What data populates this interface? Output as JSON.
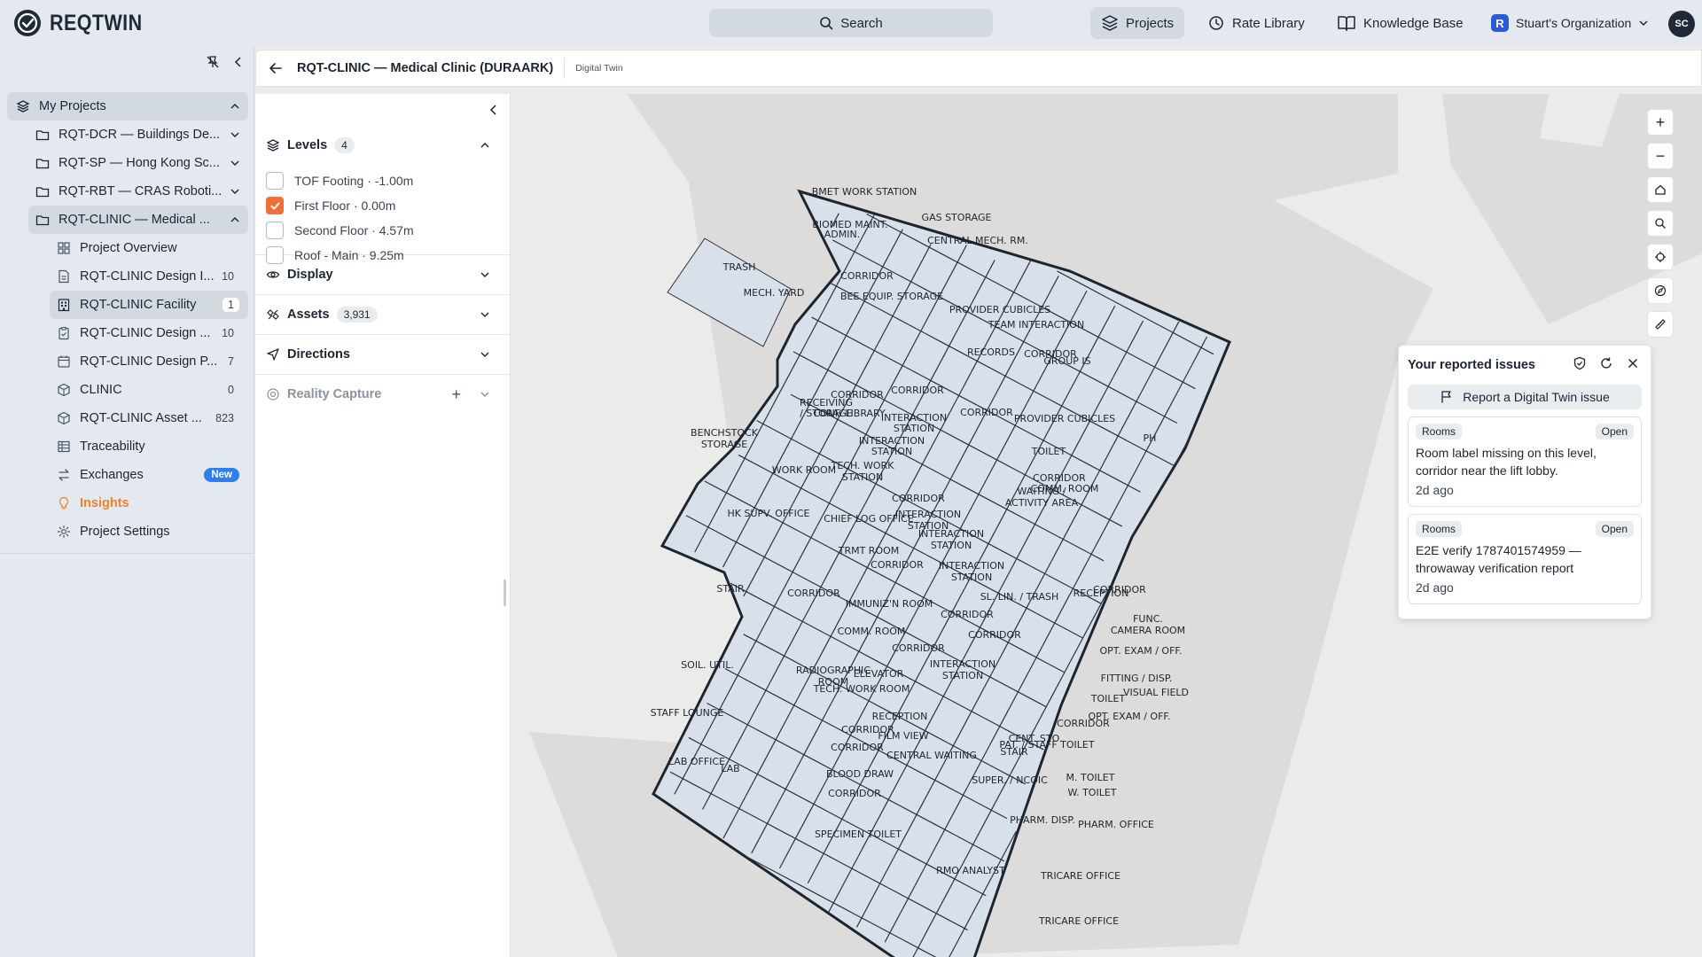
{
  "app": {
    "name": "REQTWIN"
  },
  "topbar": {
    "search_label": "Search",
    "nav": [
      {
        "label": "Projects"
      },
      {
        "label": "Rate Library"
      },
      {
        "label": "Knowledge Base"
      },
      {
        "label": "Stuart's Organization"
      }
    ],
    "org_badge": "R",
    "avatar": "SC"
  },
  "sidebar": {
    "root": "My Projects",
    "projects": [
      {
        "label": "RQT-DCR — Buildings De..."
      },
      {
        "label": "RQT-SP — Hong Kong Sc..."
      },
      {
        "label": "RQT-RBT — CRAS Roboti..."
      },
      {
        "label": "RQT-CLINIC — Medical ..."
      }
    ],
    "items": [
      {
        "label": "Project Overview",
        "count": ""
      },
      {
        "label": "RQT-CLINIC Design I...",
        "count": "10"
      },
      {
        "label": "RQT-CLINIC Facility",
        "count": "1"
      },
      {
        "label": "RQT-CLINIC Design ...",
        "count": "10"
      },
      {
        "label": "RQT-CLINIC Design P...",
        "count": "7"
      },
      {
        "label": "CLINIC",
        "count": "0"
      },
      {
        "label": "RQT-CLINIC Asset ...",
        "count": "823"
      },
      {
        "label": "Traceability",
        "count": ""
      },
      {
        "label": "Exchanges",
        "badge": "New"
      },
      {
        "label": "Insights",
        "count": ""
      },
      {
        "label": "Project Settings",
        "count": ""
      }
    ]
  },
  "header": {
    "title": "RQT-CLINIC — Medical Clinic (DURAARK)",
    "subtitle": "Digital Twin"
  },
  "panel": {
    "levels": {
      "title": "Levels",
      "count": "4",
      "items": [
        {
          "label": "TOF Footing · -1.00m",
          "checked": false
        },
        {
          "label": "First Floor · 0.00m",
          "checked": true
        },
        {
          "label": "Second Floor · 4.57m",
          "checked": false
        },
        {
          "label": "Roof - Main · 9.25m",
          "checked": false
        }
      ]
    },
    "display": {
      "title": "Display"
    },
    "assets": {
      "title": "Assets",
      "count": "3,931"
    },
    "directions": {
      "title": "Directions"
    },
    "reality": {
      "title": "Reality Capture"
    }
  },
  "map": {
    "room_labels": [
      "BMET WORK STATION",
      "BIOMED MAINT.",
      "ADMIN.",
      "GAS STORAGE",
      "CENTRAL MECH. RM.",
      "TRASH",
      "CORRIDOR",
      "MECH. YARD",
      "BEE EQUIP. STORAGE",
      "PROVIDER CUBICLES",
      "TEAM INTERACTION",
      "CORRIDOR",
      "RECORDS",
      "GROUP IS",
      "CORRIDOR",
      "CORRIDOR",
      "RECEIVING",
      "/ STORAGE",
      "CONF. LIBRARY",
      "INTERACTION",
      "STATION",
      "CORRIDOR",
      "PROVIDER CUBICLES",
      "INTERACTION",
      "STATION",
      "BENCHSTOCK",
      "STORAGE",
      "TECH. WORK",
      "STATION",
      "TOILET",
      "WORK ROOM",
      "WAITING /",
      "ACTIVITY AREA",
      "CORRIDOR",
      "COMM. ROOM",
      "HK SUPV. OFFICE",
      "CHIEF LOG OFFICE",
      "CORRIDOR",
      "INTERACTION",
      "STATION",
      "INTERACTION",
      "STATION",
      "INTERACTION",
      "STATION",
      "TRMT ROOM",
      "CORRIDOR",
      "STAIR",
      "CORRIDOR",
      "IMMUNIZ'N ROOM",
      "SL. LIN. / TRASH",
      "RECEPTION",
      "CORRIDOR",
      "CORRIDOR",
      "CORRIDOR",
      "COMM. ROOM",
      "CORRIDOR",
      "FUNC.",
      "CAMERA ROOM",
      "RADIOGRAPHIC",
      "ROOM",
      "INTERACTION",
      "STATION",
      "OPT. EXAM / OFF.",
      "SOIL. UTIL.",
      "ELEVATOR",
      "FITTING / DISP.",
      "TECH. WORK ROOM",
      "TOILET",
      "VISUAL FIELD",
      "STAFF LOUNGE",
      "RECEPTION",
      "OPT. EXAM / OFF.",
      "CORRIDOR",
      "FILM VIEW",
      "CORRIDOR",
      "CENT. STO.",
      "STAIR",
      "CORRIDOR",
      "PAT. / STAFF TOILET",
      "LAB OFFICE",
      "CENTRAL WAITING",
      "SUPER. / NCOIC",
      "M. TOILET",
      "LAB",
      "BLOOD DRAW",
      "W. TOILET",
      "CORRIDOR",
      "PHARM. DISP.",
      "PHARM. OFFICE",
      "SPECIMEN TOILET",
      "TRICARE OFFICE",
      "RMO ANALYST",
      "TRICARE OFFICE",
      "PH"
    ]
  },
  "issues": {
    "title": "Your reported issues",
    "report_label": "Report a Digital Twin issue",
    "cards": [
      {
        "category": "Rooms",
        "status": "Open",
        "text": "Room label missing on this level, corridor near the lift lobby.",
        "time": "2d ago"
      },
      {
        "category": "Rooms",
        "status": "Open",
        "text": "E2E verify 1787401574959 — throwaway verification report",
        "time": "2d ago"
      }
    ]
  },
  "colors": {
    "accent": "#f0703a",
    "insights": "#f0812a",
    "new_badge": "#2d7ff0",
    "room_fill": "#d8e1ea"
  }
}
